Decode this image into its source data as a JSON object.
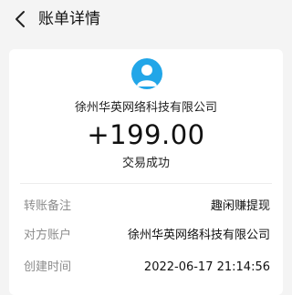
{
  "header": {
    "title": "账单详情"
  },
  "transaction": {
    "merchant": "徐州华英网络科技有限公司",
    "amount": "+199.00",
    "status": "交易成功"
  },
  "details": [
    {
      "label": "转账备注",
      "value": "趣闲赚提现"
    },
    {
      "label": "对方账户",
      "value": "徐州华英网络科技有限公司"
    },
    {
      "label": "创建时间",
      "value": "2022-06-17 21:14:56"
    }
  ],
  "colors": {
    "avatar": "#22a6e8",
    "background": "#f4f4f4",
    "card": "#ffffff",
    "label": "#8c8c8c"
  },
  "icons": {
    "back": "chevron-left-icon",
    "avatar": "user-avatar-icon"
  }
}
